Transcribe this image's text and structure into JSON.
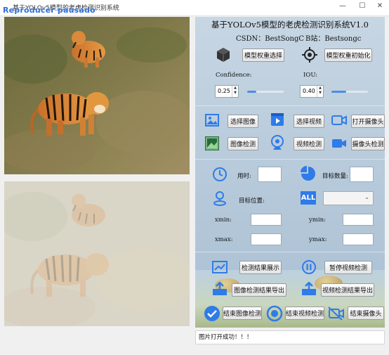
{
  "window": {
    "title": "基于YOLOv5模型的老虎检测识别系统",
    "overlay_text": "Reproducer pausado",
    "minimize": "—",
    "maximize": "☐",
    "close": "✕"
  },
  "header": {
    "title": "基于YOLOv5模型的老虎检测识别系统V1.0",
    "csdn": "CSDN：BestSongC",
    "bilibili": "B站：Bestsongc"
  },
  "model": {
    "select_label": "模型权重选择",
    "init_label": "模型权重初始化"
  },
  "params": {
    "confidence_label": "Confidence:",
    "iou_label": "IOU:",
    "confidence_value": "0.25",
    "iou_value": "0.40",
    "confidence_slider": 0.25,
    "iou_slider": 0.4
  },
  "actions": {
    "select_image": "选择图像",
    "select_video": "选择视频",
    "open_camera": "打开摄像头",
    "detect_image": "图像检测",
    "detect_video": "视频检测",
    "detect_camera": "摄像头检测"
  },
  "results": {
    "time_label": "用时:",
    "count_label": "目标数量:",
    "position_label": "目标位置:",
    "all_icon_text": "ALL",
    "xmin_label": "xmin:",
    "ymin_label": "ymin:",
    "xmax_label": "xmax:",
    "ymax_label": "ymax:"
  },
  "bottom": {
    "show_results": "检测结果展示",
    "pause_video": "暂停视频检测",
    "export_image": "图像检测结果导出",
    "export_video": "视频检测结果导出",
    "end_image": "结束图像检测",
    "end_video": "结束视频检测",
    "end_camera": "结束摄像头"
  },
  "status": {
    "message": "图片打开成功！！！"
  },
  "colors": {
    "accent": "#2f7be8",
    "panel": "#bccddc"
  }
}
